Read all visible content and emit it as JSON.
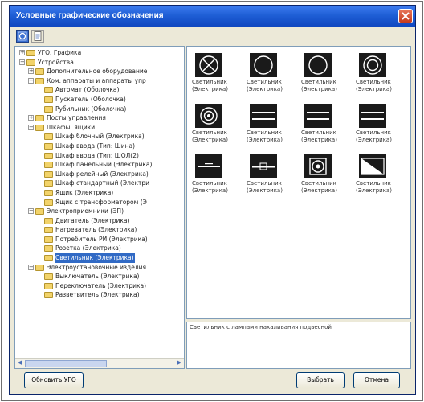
{
  "window": {
    "title": "Условные графические обозначения"
  },
  "toolbar": {
    "buttons": [
      "view-icons-icon",
      "view-list-icon"
    ]
  },
  "tree": {
    "nodes": [
      {
        "label": "УГО. Графика",
        "level": 0,
        "expander": "+",
        "selected": false
      },
      {
        "label": "Устройства",
        "level": 0,
        "expander": "-",
        "selected": false
      },
      {
        "label": "Дополнительное оборудование",
        "level": 1,
        "expander": "+",
        "selected": false
      },
      {
        "label": "Ком. аппараты и аппараты упр",
        "level": 1,
        "expander": "-",
        "selected": false
      },
      {
        "label": "Автомат (Оболочка)",
        "level": 2,
        "expander": "",
        "selected": false
      },
      {
        "label": "Пускатель (Оболочка)",
        "level": 2,
        "expander": "",
        "selected": false
      },
      {
        "label": "Рубильник (Оболочка)",
        "level": 2,
        "expander": "",
        "selected": false
      },
      {
        "label": "Посты управления",
        "level": 1,
        "expander": "+",
        "selected": false
      },
      {
        "label": "Шкафы, ящики",
        "level": 1,
        "expander": "-",
        "selected": false
      },
      {
        "label": "Шкаф блочный (Электрика)",
        "level": 2,
        "expander": "",
        "selected": false
      },
      {
        "label": "Шкаф ввода (Тип: Шина)",
        "level": 2,
        "expander": "",
        "selected": false
      },
      {
        "label": "Шкаф ввода (Тип: ШОЛ(2)",
        "level": 2,
        "expander": "",
        "selected": false
      },
      {
        "label": "Шкаф панельный (Электрика)",
        "level": 2,
        "expander": "",
        "selected": false
      },
      {
        "label": "Шкаф релейный (Электрика)",
        "level": 2,
        "expander": "",
        "selected": false
      },
      {
        "label": "Шкаф стандартный (Электри",
        "level": 2,
        "expander": "",
        "selected": false
      },
      {
        "label": "Ящик (Электрика)",
        "level": 2,
        "expander": "",
        "selected": false
      },
      {
        "label": "Ящик с трансформатором (Э",
        "level": 2,
        "expander": "",
        "selected": false
      },
      {
        "label": "Электроприемники (ЭП)",
        "level": 1,
        "expander": "-",
        "selected": false
      },
      {
        "label": "Двигатель (Электрика)",
        "level": 2,
        "expander": "",
        "selected": false
      },
      {
        "label": "Нагреватель (Электрика)",
        "level": 2,
        "expander": "",
        "selected": false
      },
      {
        "label": "Потребитель РИ (Электрика)",
        "level": 2,
        "expander": "",
        "selected": false
      },
      {
        "label": "Розетка (Электрика)",
        "level": 2,
        "expander": "",
        "selected": false
      },
      {
        "label": "Светильник (Электрика)",
        "level": 2,
        "expander": "",
        "selected": true
      },
      {
        "label": "Электроустановочные изделия",
        "level": 1,
        "expander": "-",
        "selected": false
      },
      {
        "label": "Выключатель (Электрика)",
        "level": 2,
        "expander": "",
        "selected": false
      },
      {
        "label": "Переключатель (Электрика)",
        "level": 2,
        "expander": "",
        "selected": false
      },
      {
        "label": "Разветвитель (Электрика)",
        "level": 2,
        "expander": "",
        "selected": false
      }
    ]
  },
  "symbols": {
    "items": [
      {
        "line1": "Светильник",
        "line2": "(Электрика)",
        "icon": "lamp-cross-circle-icon"
      },
      {
        "line1": "Светильник",
        "line2": "(Электрика)",
        "icon": "lamp-circle-icon"
      },
      {
        "line1": "Светильник",
        "line2": "(Электрика)",
        "icon": "lamp-circle-icon"
      },
      {
        "line1": "Светильник",
        "line2": "(Электрика)",
        "icon": "lamp-double-circle-icon"
      },
      {
        "line1": "Светильник",
        "line2": "(Электрика)",
        "icon": "lamp-target-icon"
      },
      {
        "line1": "Светильник",
        "line2": "(Электрика)",
        "icon": "lamp-double-bar-icon"
      },
      {
        "line1": "Светильник",
        "line2": "(Электрика)",
        "icon": "lamp-double-bar-icon"
      },
      {
        "line1": "Светильник",
        "line2": "(Электрика)",
        "icon": "lamp-double-bar-icon"
      },
      {
        "line1": "Светильник",
        "line2": "(Электрика)",
        "icon": "lamp-small-bar-icon"
      },
      {
        "line1": "Светильник",
        "line2": "(Электрика)",
        "icon": "lamp-bar-icon"
      },
      {
        "line1": "Светильник",
        "line2": "(Электрика)",
        "icon": "lamp-square-target-icon"
      },
      {
        "line1": "Светильник",
        "line2": "(Электрика)",
        "icon": "lamp-diagonal-icon"
      }
    ]
  },
  "status": {
    "text": "Светильник с лампами накаливания подвесной"
  },
  "buttons": {
    "update": "Обновить УГО",
    "choose": "Выбрать",
    "cancel": "Отмена"
  }
}
